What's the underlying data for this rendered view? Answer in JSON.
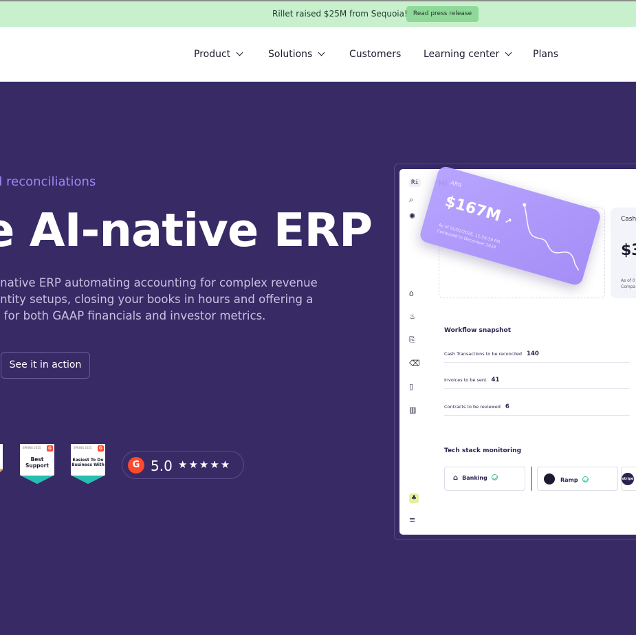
{
  "banner": {
    "text": "Rillet raised $25M from Sequoia!",
    "button_label": "Read press release"
  },
  "nav": {
    "items": [
      {
        "label": "Product",
        "has_dropdown": true
      },
      {
        "label": "Solutions",
        "has_dropdown": true
      },
      {
        "label": "Customers",
        "has_dropdown": false
      },
      {
        "label": "Learning center",
        "has_dropdown": true
      },
      {
        "label": "Plans",
        "has_dropdown": false
      }
    ]
  },
  "hero": {
    "eyebrow": "d reconciliations",
    "headline": "e AI-native ERP",
    "description_lines": [
      "enative ERP automating accounting for complex revenue",
      "entity setups, closing your books in hours and offering a",
      "n for both GAAP financials and investor metrics."
    ],
    "cta_label": "See it in action"
  },
  "badges": [
    {
      "top": "SPRING 2025",
      "label": "Best Support"
    },
    {
      "top": "SPRING 2025",
      "label": "Easiest To Do Business With"
    }
  ],
  "rating": {
    "logo": "G",
    "score": "5.0",
    "stars": "★★★★★"
  },
  "dashboard": {
    "workspace": "Ri",
    "greeting": "Hi ",
    "arr_card": {
      "label": "ARR",
      "amount": "$167M",
      "as_of": "As of 01/01/2026, 11:59:59 PM",
      "compared": "Compared to December 2024"
    },
    "cash_card": {
      "title": "Cash",
      "amount": "$3",
      "as_of": "As of 0",
      "compared": "Compa"
    },
    "workflow": {
      "title": "Workflow snapshot",
      "rows": [
        {
          "label": "Cash Transactions to be reconciled",
          "count": "140"
        },
        {
          "label": "Invoices to be sent",
          "count": "41"
        },
        {
          "label": "Contracts to be reviewed",
          "count": "6"
        }
      ]
    },
    "tech_stack": {
      "title": "Tech stack monitoring",
      "items": [
        {
          "label": "Banking"
        },
        {
          "label": "Ramp"
        },
        {
          "label": "stripe"
        }
      ]
    }
  },
  "colors": {
    "background": "#372a65",
    "banner": "#c8f0cc",
    "accent": "#9f86f5",
    "g2_red": "#ff492c"
  }
}
